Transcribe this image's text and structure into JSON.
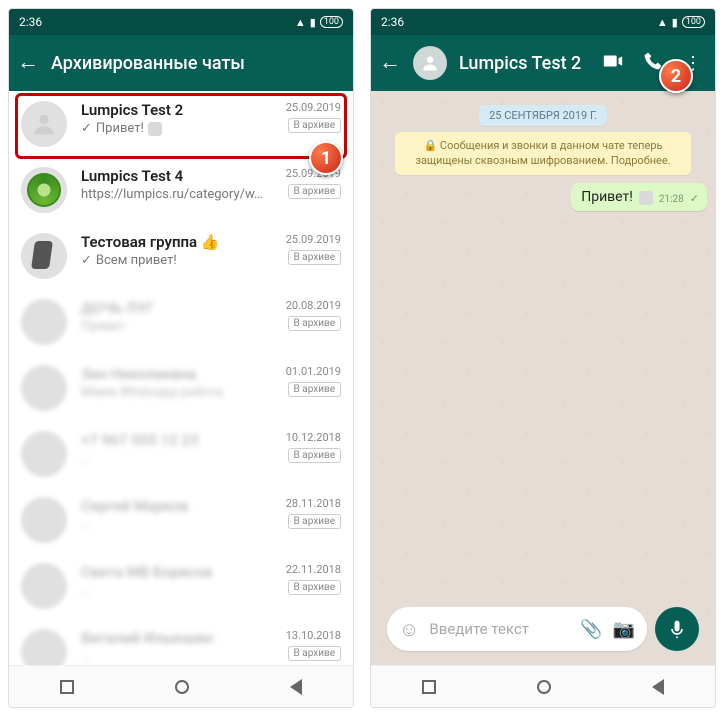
{
  "status": {
    "time": "2:36",
    "battery": "100"
  },
  "screen1": {
    "title": "Архивированные чаты",
    "archived_label": "В архиве",
    "chats": [
      {
        "name": "Lumpics Test 2",
        "msg": "Привет!",
        "date": "25.09.2019",
        "tick": true
      },
      {
        "name": "Lumpics Test 4",
        "msg": "https://lumpics.ru/category/w…",
        "date": "25.09.2019"
      },
      {
        "name": "Тестовая группа 👍",
        "msg": "Всем привет!",
        "date": "25.09.2019",
        "tick": true
      },
      {
        "name": "ДОЧЬ ЛУГ",
        "msg": "Привет",
        "date": "20.08.2019",
        "blurred": true
      },
      {
        "name": "Зин Николаевна",
        "msg": "Мама Whatsapp работа",
        "date": "01.01.2019",
        "blurred": true
      },
      {
        "name": "+7 967 555 12 23",
        "msg": "…",
        "date": "10.12.2018",
        "blurred": true
      },
      {
        "name": "Сергей Марков",
        "msg": "…",
        "date": "28.11.2018",
        "blurred": true
      },
      {
        "name": "Света МВ Борисов",
        "msg": "…",
        "date": "22.11.2018",
        "blurred": true
      },
      {
        "name": "Виталий Ильюшин",
        "msg": "…",
        "date": "13.10.2018",
        "blurred": true
      }
    ]
  },
  "screen2": {
    "title": "Lumpics Test 2",
    "date_chip": "25 СЕНТЯБРЯ 2019 Г.",
    "encryption": "🔒 Сообщения и звонки в данном чате теперь защищены сквозным шифрованием. Подробнее.",
    "message": {
      "text": "Привет!",
      "time": "21:28"
    },
    "input_placeholder": "Введите текст"
  },
  "badges": {
    "one": "1",
    "two": "2"
  }
}
